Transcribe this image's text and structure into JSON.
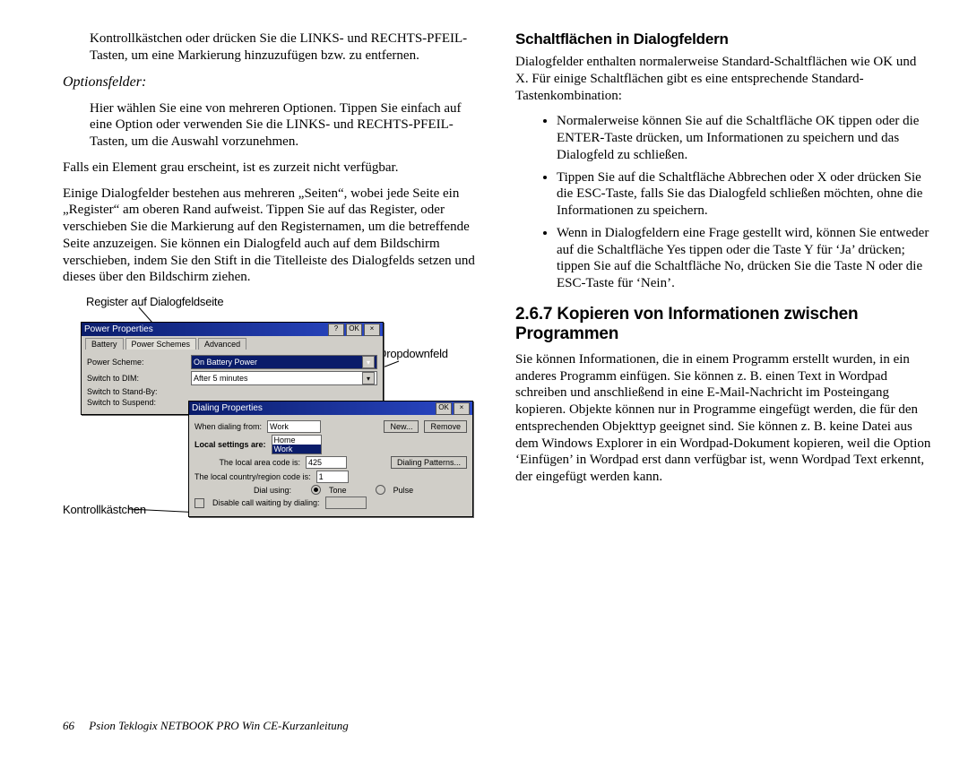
{
  "left": {
    "p_top": "Kontrollkästchen oder drücken Sie die LINKS- und RECHTS-PFEIL-Tasten, um eine Markierung hinzuzufügen bzw. zu entfernen.",
    "opt_head": "Optionsfelder:",
    "opt_body": "Hier wählen Sie eine von mehreren Optionen. Tippen Sie einfach auf eine Option oder verwenden Sie die LINKS- und RECHTS-PFEIL-Tasten, um die Auswahl vorzunehmen.",
    "p_grey": "Falls ein Element grau erscheint, ist es zurzeit nicht verfügbar.",
    "p_pages": "Einige Dialogfelder bestehen aus mehreren „Seiten“, wobei jede Seite ein „Register“ am oberen Rand aufweist. Tippen Sie auf das Register, oder verschieben Sie die Markierung auf den Registernamen, um die betreffende Seite anzuzeigen. Sie können ein Dialogfeld auch auf dem Bildschirm verschieben, indem Sie den Stift in die Titelleiste des Dialogfelds setzen und dieses über den Bildschirm ziehen."
  },
  "callouts": {
    "register": "Register auf Dialogfeldseite",
    "dropdown": "Dropdownfeld",
    "kontroll": "Kontrollkästchen"
  },
  "win1": {
    "title": "Power Properties",
    "help": "?",
    "ok": "OK",
    "close": "×",
    "tabs": [
      "Battery",
      "Power Schemes",
      "Advanced"
    ],
    "row1_label": "Power Scheme:",
    "row1_val": "On Battery Power",
    "row2_label": "Switch to DIM:",
    "row2_val": "After 5 minutes",
    "row3_label": "Switch to Stand-By:",
    "row4_label": "Switch to Suspend:"
  },
  "win2": {
    "title": "Dialing Properties",
    "ok": "OK",
    "close": "×",
    "dial_from": "When dialing from:",
    "dial_opt_home": "Home",
    "dial_opt_work": "Work",
    "sel": "Work",
    "new": "New...",
    "remove": "Remove",
    "loc_label": "Local settings are:",
    "area_label": "The local area code is:",
    "area_val": "425",
    "patterns": "Dialing Patterns...",
    "country_label": "The local country/region code is:",
    "country_val": "1",
    "dial_using": "Dial using:",
    "tone": "Tone",
    "pulse": "Pulse",
    "disable": "Disable call waiting by dialing:"
  },
  "right": {
    "h3": "Schaltflächen in Dialogfeldern",
    "p_intro": "Dialogfelder enthalten normalerweise Standard-Schaltflächen wie OK und X. Für einige Schaltflächen gibt es eine entsprechende Standard-Tastenkombination:",
    "li1": "Normalerweise können Sie auf die Schaltfläche OK tippen oder die ENTER-Taste drücken, um Informationen zu speichern und das Dialogfeld zu schließen.",
    "li2": "Tippen Sie auf die Schaltfläche Abbrechen oder X oder drücken Sie die ESC-Taste, falls Sie das Dialogfeld schließen möchten, ohne die Informationen zu speichern.",
    "li3": "Wenn in Dialogfeldern eine Frage gestellt wird, können Sie entweder auf die Schaltfläche Yes tippen oder die Taste Y für ‘Ja’ drücken; tippen Sie auf die Schaltfläche No, drücken Sie die Taste N oder die ESC-Taste für ‘Nein’.",
    "h2": "2.6.7  Kopieren von Informationen zwischen Programmen",
    "p_copy": "Sie können Informationen, die in einem Programm erstellt wurden, in ein anderes Programm einfügen. Sie können z. B. einen Text in Wordpad schreiben und anschließend in eine E-Mail-Nachricht im Posteingang kopieren. Objekte können nur in Programme eingefügt werden, die für den entsprechenden Objekttyp geeignet sind. Sie können z. B. keine Datei aus dem Windows Explorer in ein Wordpad-Dokument kopieren, weil die Option ‘Einfügen’ in Wordpad erst dann verfügbar ist, wenn Wordpad Text erkennt, der eingefügt werden kann."
  },
  "footer": {
    "page": "66",
    "title": "Psion Teklogix NETBOOK PRO Win CE-Kurzanleitung"
  }
}
